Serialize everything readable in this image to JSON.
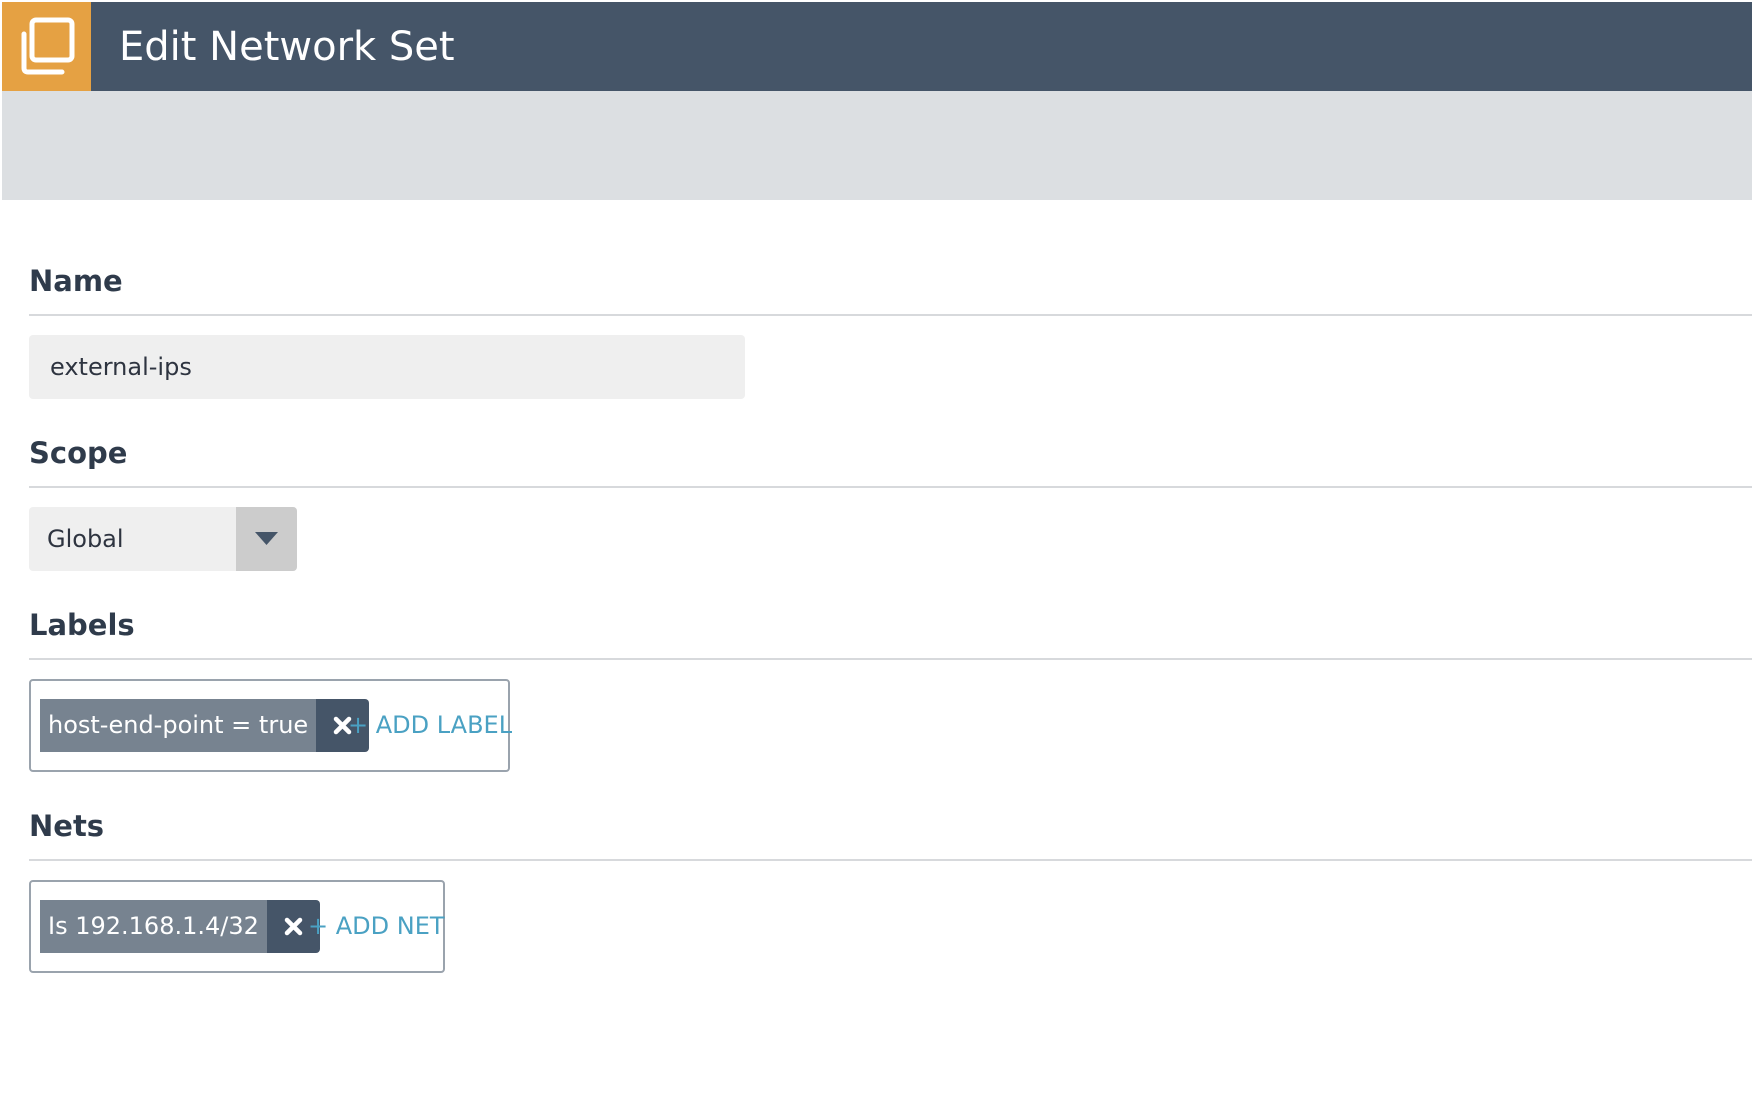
{
  "header": {
    "title": "Edit Network Set",
    "logo_icon": "copy-windows-icon",
    "brand_color": "#e5a143",
    "bar_color": "#455568"
  },
  "form": {
    "name": {
      "label": "Name",
      "value": "external-ips"
    },
    "scope": {
      "label": "Scope",
      "selected": "Global"
    },
    "labels": {
      "label": "Labels",
      "tags": [
        {
          "text": "host-end-point = true"
        }
      ],
      "add_label": "+ ADD LABEL"
    },
    "nets": {
      "label": "Nets",
      "tags": [
        {
          "text": "Is 192.168.1.4/32"
        }
      ],
      "add_label": "+ ADD NET"
    }
  },
  "colors": {
    "accent_link": "#4aa1c3",
    "tag_background": "#778390",
    "tag_remove_background": "#455568"
  }
}
